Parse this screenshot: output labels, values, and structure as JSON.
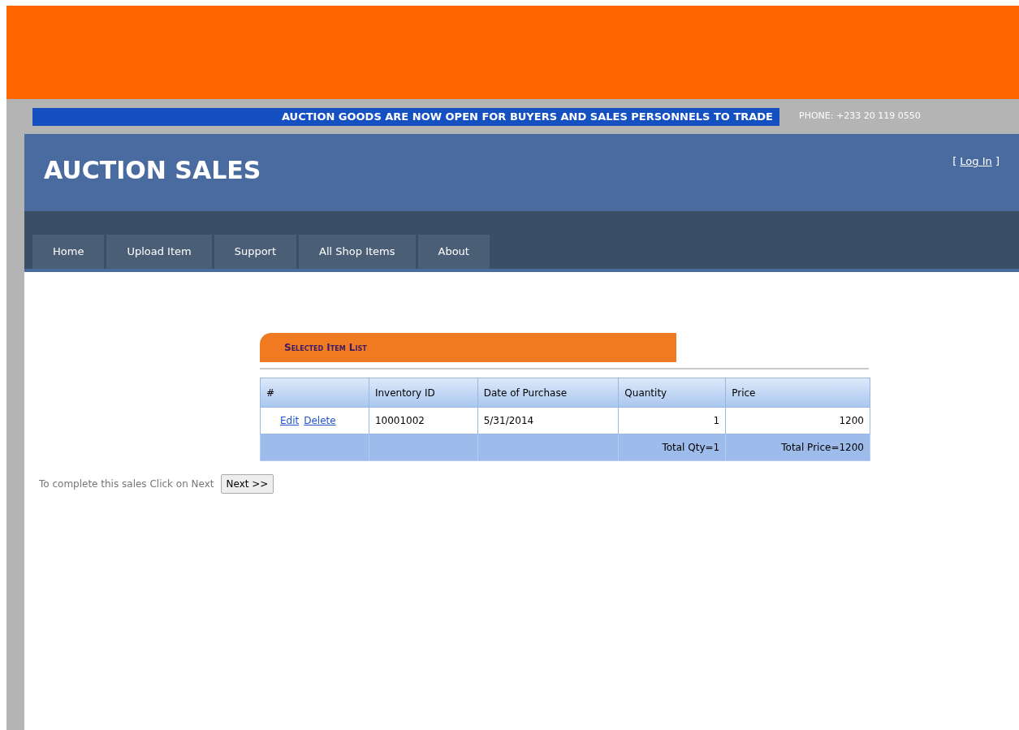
{
  "marquee": "AUCTION GOODS ARE NOW OPEN FOR BUYERS AND SALES PERSONNELS TO TRADE",
  "phone": "PHONE: +233 20 119 0550",
  "site_title": "AUCTION SALES",
  "login": {
    "open": "[ ",
    "link": "Log In",
    "close": " ]"
  },
  "nav": [
    "Home",
    "Upload Item",
    "Support",
    "All Shop Items",
    "About"
  ],
  "panel_title": "Selected Item List",
  "table": {
    "columns": [
      "#",
      "Inventory ID",
      "Date of Purchase",
      "Quantity",
      "Price"
    ],
    "rows": [
      {
        "actions": [
          "Edit",
          "Delete"
        ],
        "inventory_id": "10001002",
        "date": "5/31/2014",
        "quantity": "1",
        "price": "1200"
      }
    ],
    "footer": {
      "quantity": "Total Qty=1",
      "price": "Total Price=1200"
    }
  },
  "instruction": "To complete this sales Click on Next",
  "next_button": "Next >>"
}
